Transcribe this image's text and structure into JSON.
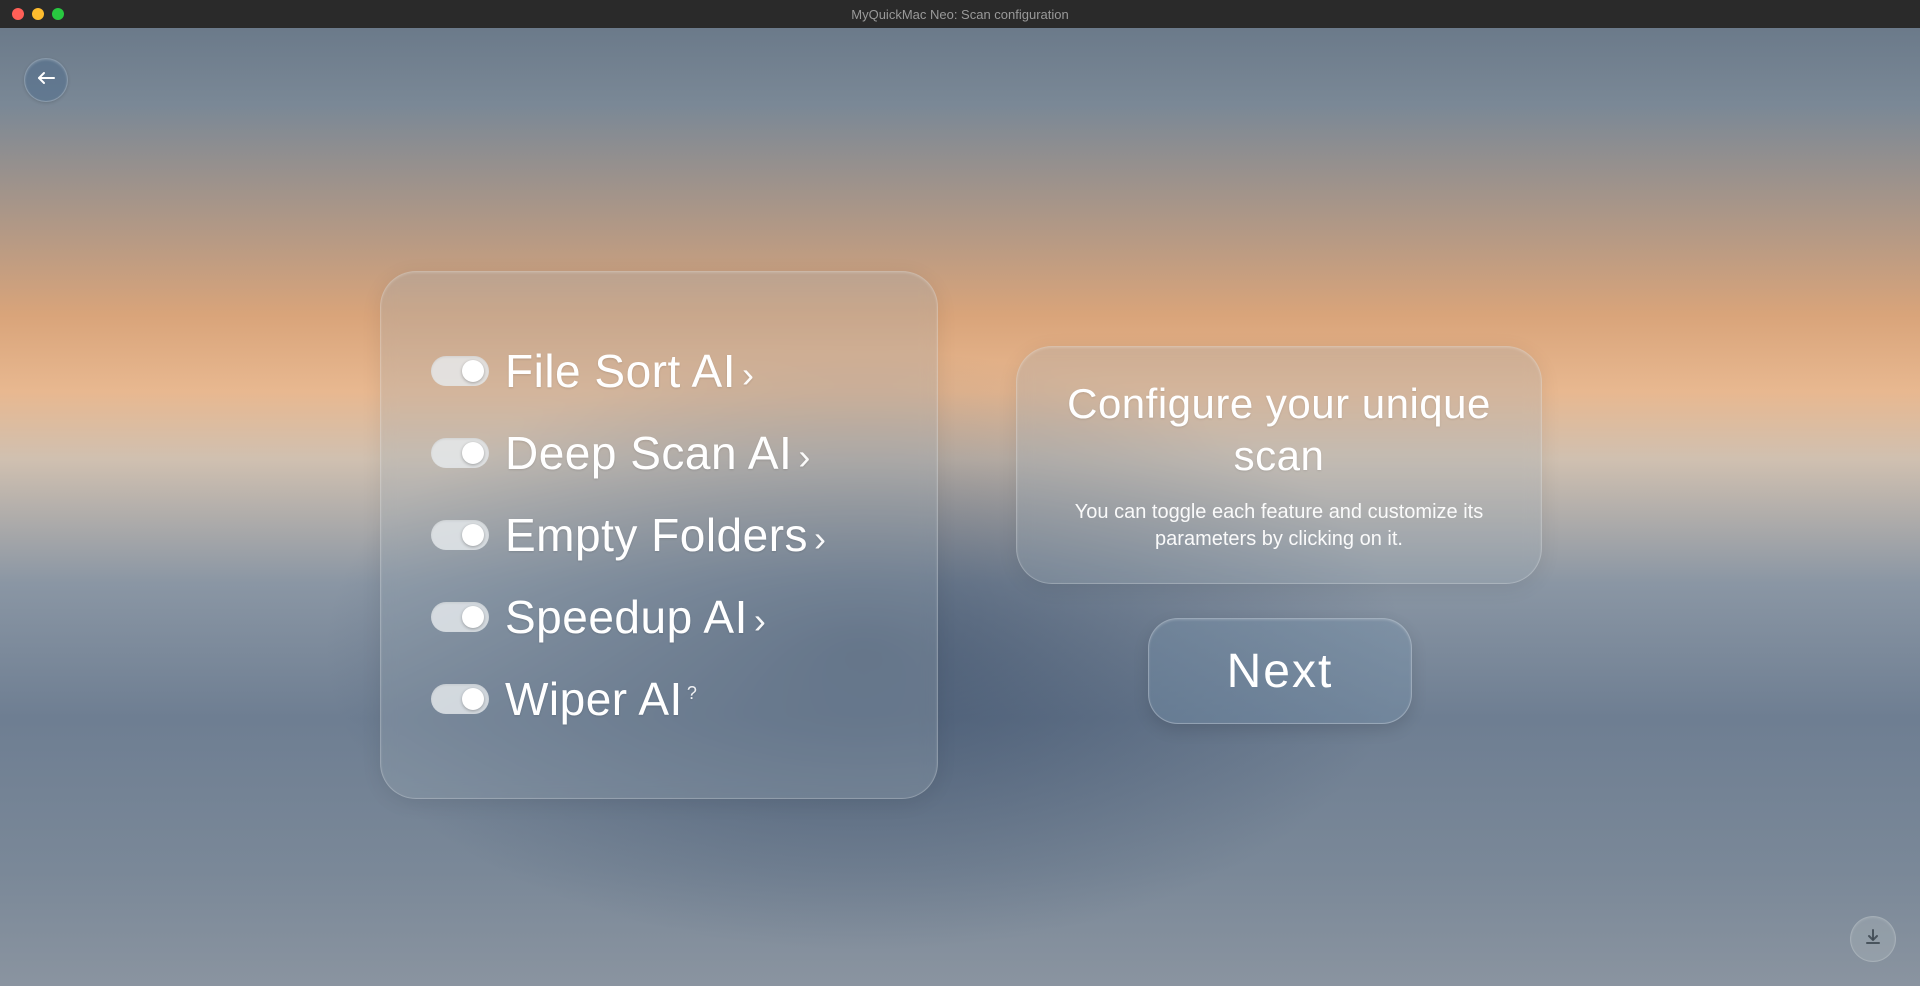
{
  "window": {
    "title": "MyQuickMac Neo: Scan configuration"
  },
  "features": [
    {
      "label": "File Sort AI",
      "suffix": "chevron",
      "enabled": true
    },
    {
      "label": "Deep Scan AI",
      "suffix": "chevron",
      "enabled": true
    },
    {
      "label": "Empty Folders",
      "suffix": "chevron",
      "enabled": true
    },
    {
      "label": "Speedup AI",
      "suffix": "chevron",
      "enabled": true
    },
    {
      "label": "Wiper AI",
      "suffix": "qmark",
      "enabled": true
    }
  ],
  "info": {
    "title": "Configure your unique scan",
    "desc": "You can toggle each feature and customize its parameters by clicking on it."
  },
  "buttons": {
    "next": "Next"
  },
  "suffix_glyphs": {
    "chevron": "›",
    "qmark": "?"
  }
}
